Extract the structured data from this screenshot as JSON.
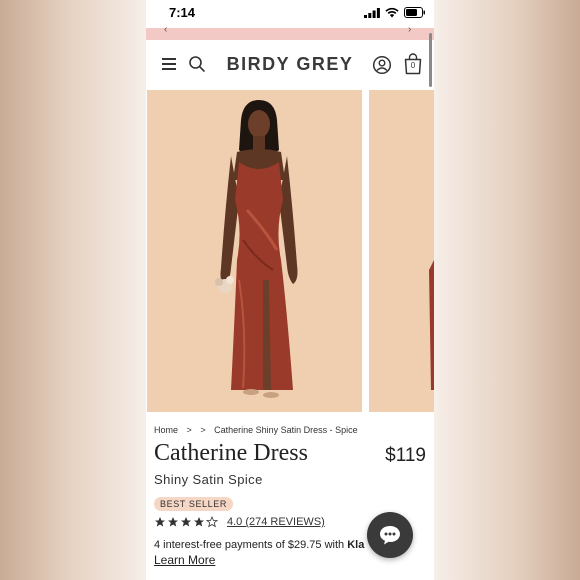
{
  "status_bar": {
    "time": "7:14"
  },
  "header": {
    "logo": "BIRDY GREY",
    "icons": [
      "hamburger-menu-icon",
      "search-icon",
      "account-icon",
      "shopping-bag-icon"
    ],
    "cart_count": "0"
  },
  "gallery": {
    "image_description_icons": [
      "model-photo",
      "model-photo-next"
    ]
  },
  "breadcrumb": {
    "items": [
      "Home",
      "",
      "Catherine Shiny Satin Dress - Spice"
    ],
    "separator": ">"
  },
  "product": {
    "title": "Catherine Dress",
    "price": "$119",
    "variant": "Shiny Satin Spice",
    "badge": "BEST SELLER",
    "rating_value": 4.0,
    "rating_text": "4.0 (274 REVIEWS)",
    "payment_text": "4 interest-free payments of $29.75 with ",
    "payment_provider": "Kla",
    "learn_more": "Learn More"
  },
  "colors": {
    "promo_banner": "#f2c9c4",
    "photo_bg": "#efcfb0",
    "dress": "#9a3a2a",
    "badge_bg": "#f6d6c4",
    "chat_bg": "#3a3a3a"
  }
}
